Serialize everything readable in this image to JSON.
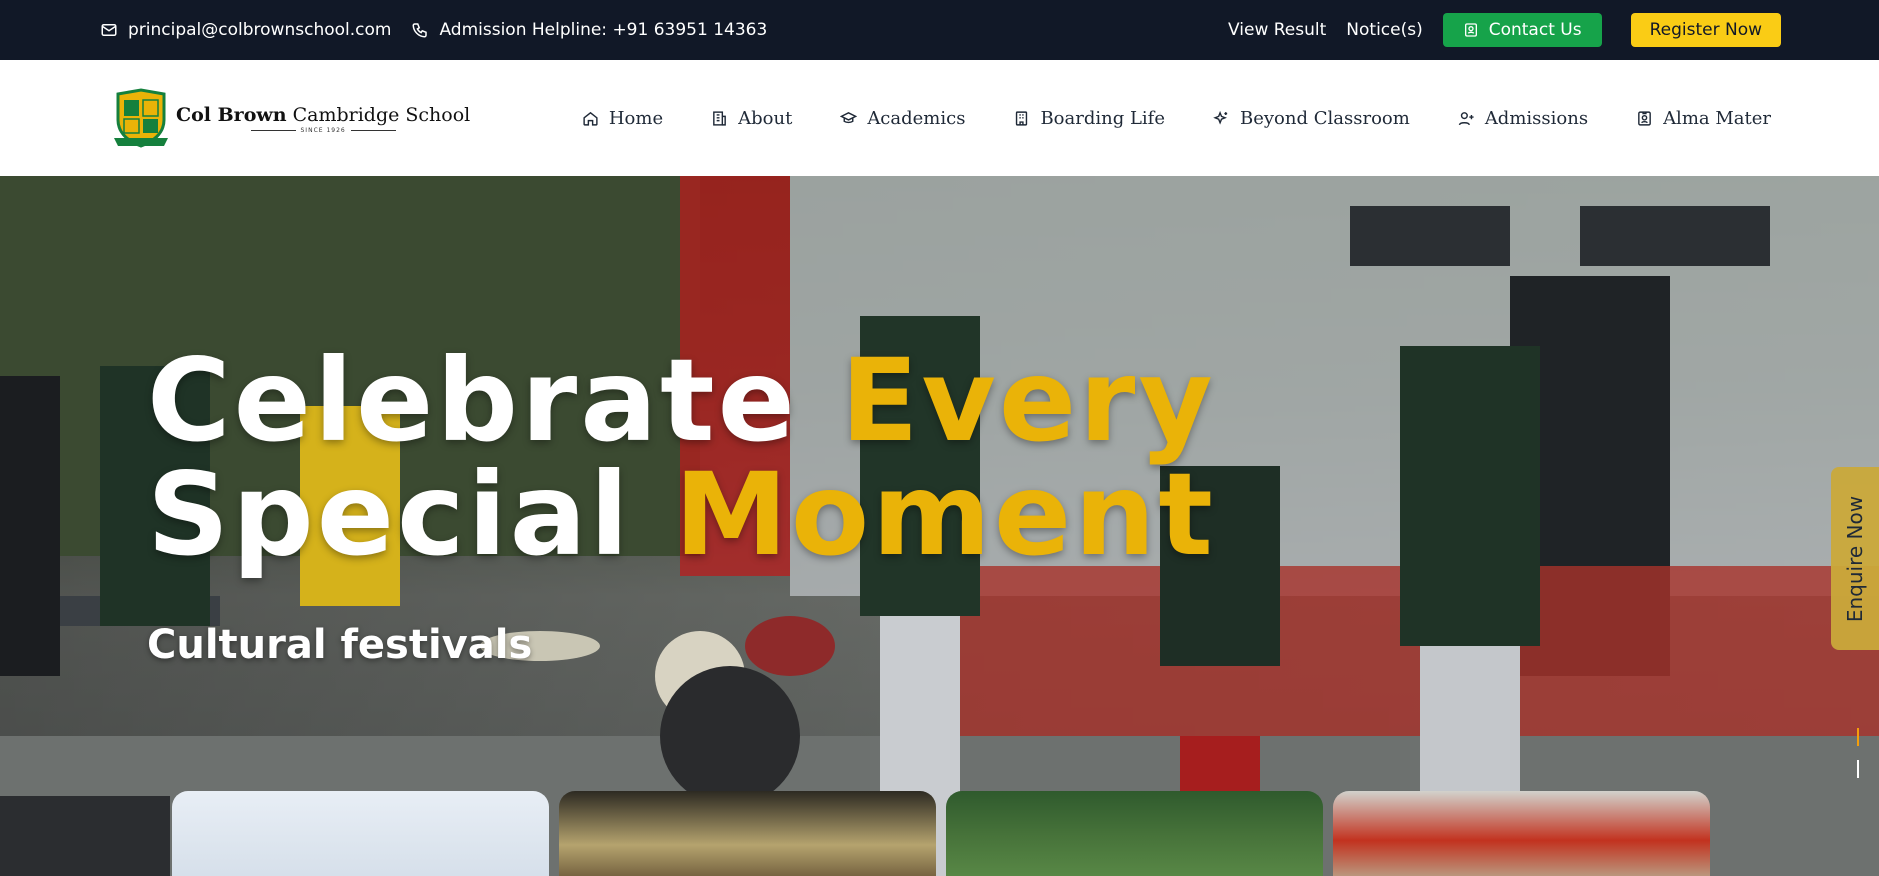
{
  "topbar": {
    "email": "principal@colbrownschool.com",
    "helpline": "Admission Helpline: +91 63951 14363",
    "view_result": "View Result",
    "notices": "Notice(s)",
    "contact_us": "Contact Us",
    "register_now": "Register Now"
  },
  "brand": {
    "name_bold": "Col Brown",
    "name_rest": " Cambridge School",
    "since": "SINCE 1926"
  },
  "nav": {
    "items": [
      {
        "label": "Home",
        "icon": "home-icon"
      },
      {
        "label": "About",
        "icon": "building-icon"
      },
      {
        "label": "Academics",
        "icon": "graduation-cap-icon"
      },
      {
        "label": "Boarding Life",
        "icon": "hostel-icon"
      },
      {
        "label": "Beyond Classroom",
        "icon": "sparkles-icon"
      },
      {
        "label": "Admissions",
        "icon": "user-plus-icon"
      },
      {
        "label": "Alma Mater",
        "icon": "id-badge-icon"
      }
    ]
  },
  "hero": {
    "line1_white": "Celebrate ",
    "line1_accent": "Every",
    "line2_white": "Special ",
    "line2_accent": "Moment",
    "subtitle": "Cultural festivals",
    "enquire": "Enquire Now"
  },
  "colors": {
    "topbar_bg": "#111827",
    "contact_green": "#16a34a",
    "register_yellow": "#facc15",
    "accent_gold": "#eab308"
  }
}
